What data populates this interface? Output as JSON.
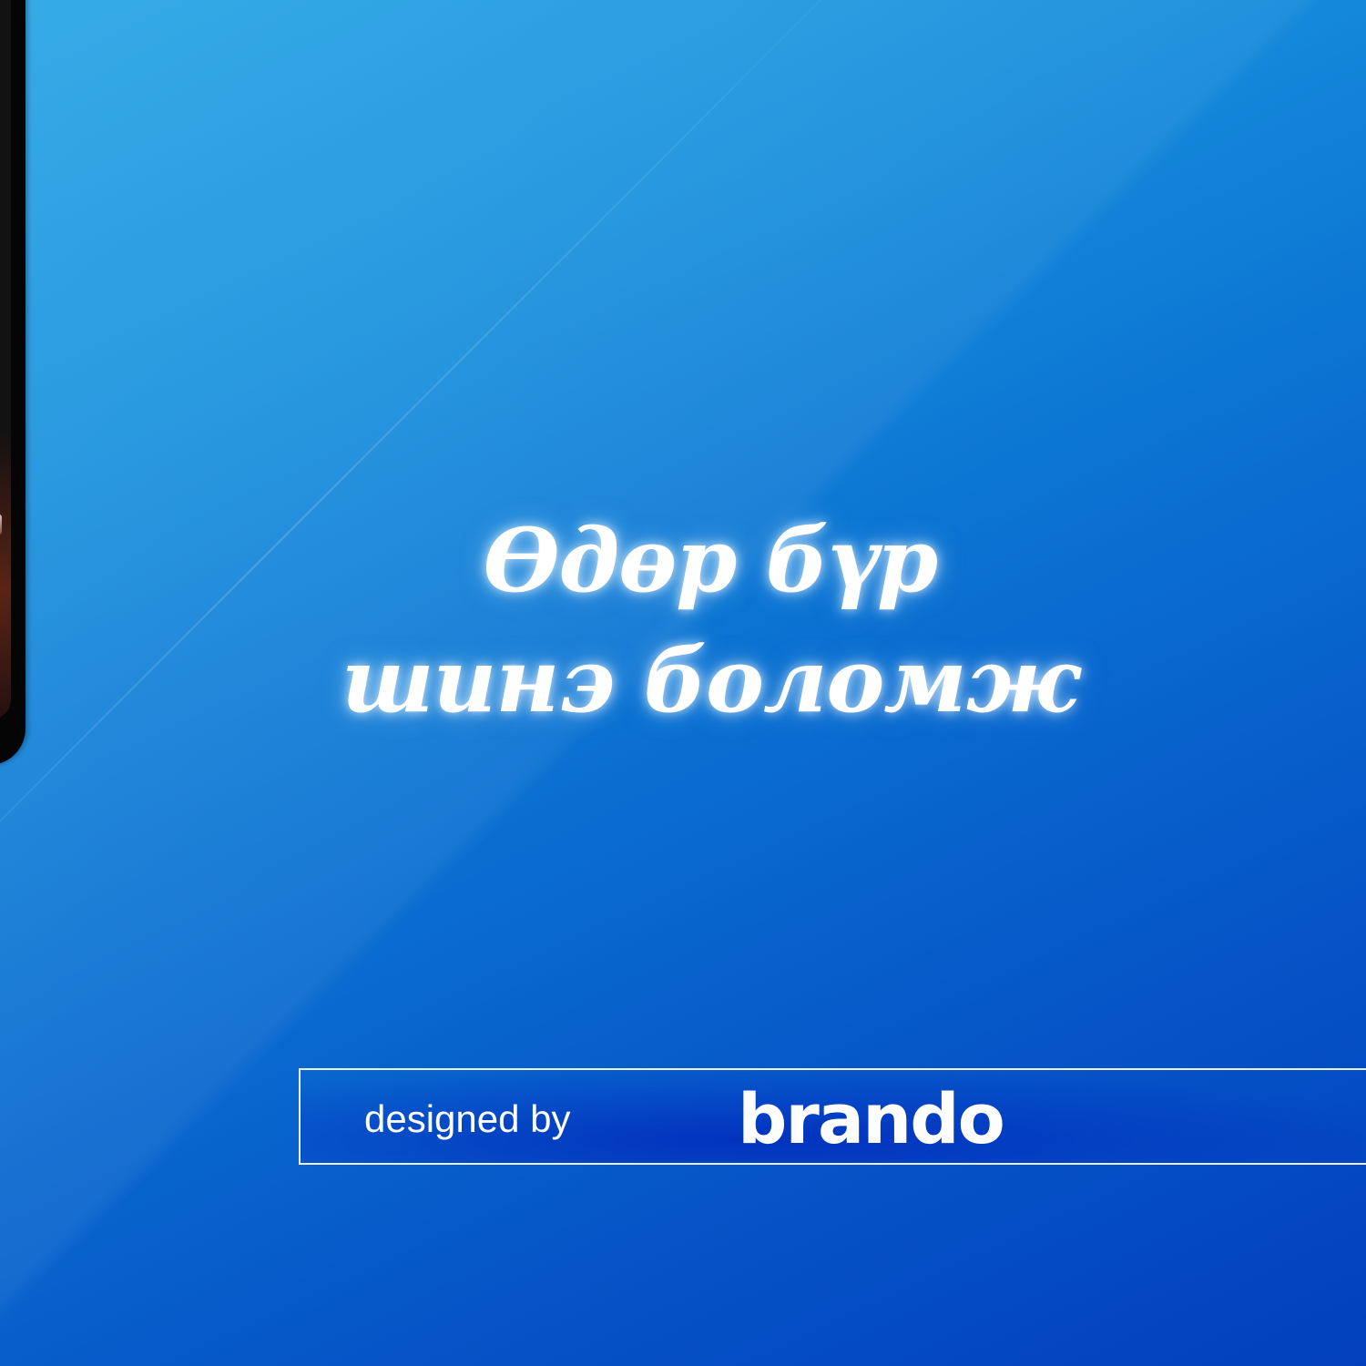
{
  "slogan": {
    "line1": "Өдөр бүр",
    "line2": "шинэ боломж"
  },
  "credit": {
    "designed_by": "designed by",
    "brand": "brando"
  },
  "colors": {
    "background_top": "#1fa3e4",
    "background_bottom": "#023fbd",
    "text": "#ffffff",
    "box_border": "#ffffff"
  }
}
